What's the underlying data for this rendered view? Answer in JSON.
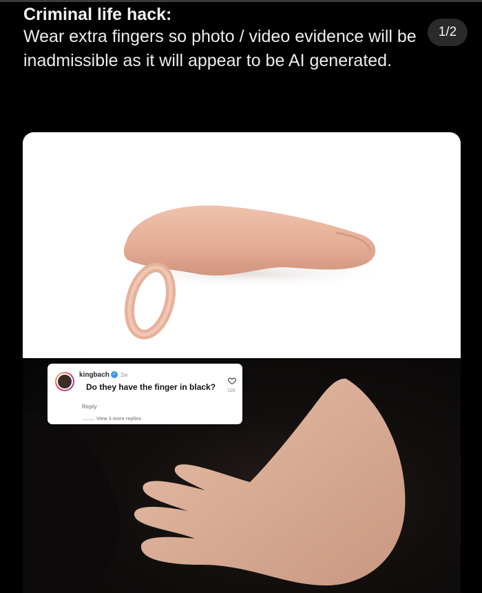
{
  "post": {
    "heading": "Criminal life hack:",
    "body": "Wear extra fingers so photo / video evidence will be inadmissible as it will appear to be AI generated."
  },
  "pager": {
    "label": "1/2"
  },
  "comment": {
    "username": "kingbach",
    "verified_icon": "verified-check-icon",
    "time": "2w",
    "text": "Do they have the finger in black?",
    "likes": "118",
    "reply_label": "Reply",
    "view_replies": "View 3 more replies"
  },
  "colors": {
    "background": "#000000",
    "card": "#ffffff",
    "verified": "#3897f0",
    "muted": "#8e8e8e"
  }
}
